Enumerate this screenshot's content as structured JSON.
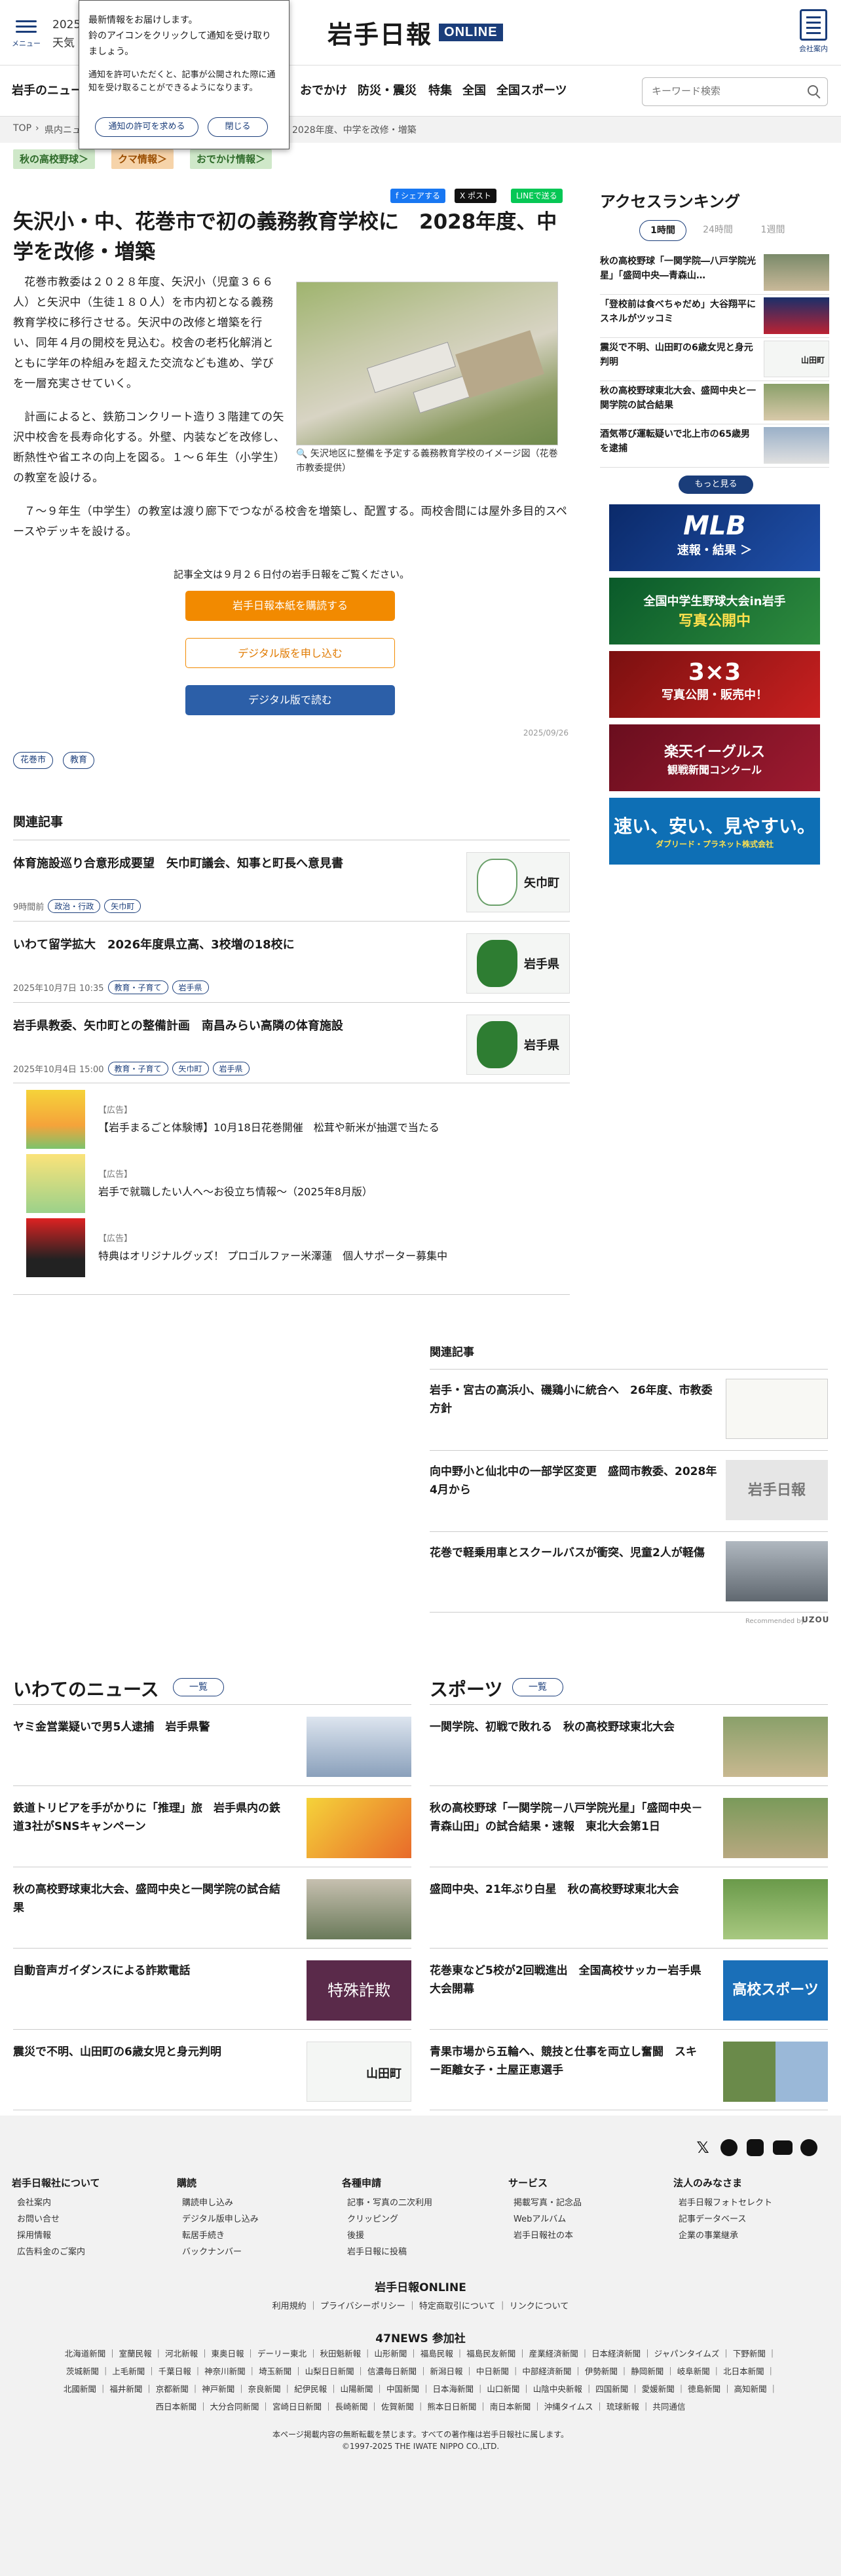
{
  "header": {
    "menu_label": "メニュー",
    "date_text": "2025.",
    "weather_text": "天気",
    "logo_jp": "岩手日報",
    "logo_online": "ONLINE",
    "company_label": "会社案内"
  },
  "popup": {
    "line1": "最新情報をお届けします。",
    "line2": "鈴のアイコンをクリックして通知を受け取りましょう。",
    "line3": "通知を許可いただくと、記事が公開された際に通知を受け取ることができるようになります。",
    "allow_button": "通知の許可を求める",
    "close_button": "閉じる"
  },
  "nav": {
    "items": [
      "岩手のニュー",
      "おでかけ",
      "防災・震災",
      "特集",
      "全国",
      "全国スポーツ"
    ],
    "search_placeholder": "キーワード検索"
  },
  "breadcrumb": {
    "top": "TOP",
    "sep": "›",
    "section": "県内ニュ",
    "current": "2028年度、中学を改修・増築"
  },
  "topic_tags": [
    "秋の高校野球＞",
    "クマ情報＞",
    "おでかけ情報＞"
  ],
  "share": {
    "facebook": "f シェアする",
    "x": "X ポスト",
    "line": "LINEで送る"
  },
  "article": {
    "title": "矢沢小・中、花巻市で初の義務教育学校に　2028年度、中学を改修・増築",
    "para1": "花巻市教委は２０２８年度、矢沢小（児童３６６人）と矢沢中（生徒１８０人）を市内初となる義務教育学校に移行させる。矢沢中の改修と増築を行い、同年４月の開校を見込む。校舎の老朽化解消とともに学年の枠組みを超えた交流なども進め、学びを一層充実させていく。",
    "para2": "計画によると、鉄筋コンクリート造り３階建ての矢沢中校舎を長寿命化する。外壁、内装などを改修し、断熱性や省エネの向上を図る。１～６年生（小学生）の教室を設ける。",
    "para3": "７～９年生（中学生）の教室は渡り廊下でつながる校舎を増築し、配置する。両校舎間には屋外多目的スペースやデッキを設ける。",
    "image_caption": "矢沢地区に整備を予定する義務教育学校のイメージ図（花巻市教委提供）",
    "paywall_note": "記事全文は９月２６日付の岩手日報をご覧ください。",
    "btn_buy": "岩手日報本紙を購読する",
    "btn_digital_apply": "デジタル版を申し込む",
    "btn_digital_read": "デジタル版で読む",
    "date": "2025/09/26",
    "keywords": [
      "花巻市",
      "教育"
    ]
  },
  "related": {
    "heading": "関連記事",
    "items": [
      {
        "title": "体育施設巡り合意形成要望　矢巾町議会、知事と町長へ意見書",
        "meta": "9時間前",
        "tags": [
          "政治・行政",
          "矢巾町"
        ],
        "thumb_label": "矢巾町",
        "thumb_color": "#ffffff"
      },
      {
        "title": "いわて留学拡大　2026年度県立高、3校増の18校に",
        "meta": "2025年10月7日 10:35",
        "tags": [
          "教育・子育て",
          "岩手県"
        ],
        "thumb_label": "岩手県",
        "thumb_color": "#2e7d32"
      },
      {
        "title": "岩手県教委、矢巾町との整備計画　南昌みらい高隣の体育施設",
        "meta": "2025年10月4日 15:00",
        "tags": [
          "教育・子育て",
          "矢巾町",
          "岩手県"
        ],
        "thumb_label": "岩手県",
        "thumb_color": "#2e7d32"
      }
    ]
  },
  "ads": [
    {
      "pr": "【広告】",
      "title": "【岩手まるごと体験博】10月18日花巻開催　松茸や新米が抽選で当たる"
    },
    {
      "pr": "【広告】",
      "title": "岩手で就職したい人へ～お役立ち情報～（2025年8月版）"
    },
    {
      "pr": "【広告】",
      "title": "特典はオリジナルグッズ！ プロゴルファー米澤蓮　個人サポーター募集中"
    }
  ],
  "ranking": {
    "title": "アクセスランキング",
    "tabs": [
      "1時間",
      "24時間",
      "1週間"
    ],
    "items": [
      "秋の高校野球「一関学院―八戸学院光星」「盛岡中央―青森山…",
      "「登校前は食べちゃだめ」大谷翔平にスネルがツッコミ",
      "震災で不明、山田町の6歳女児と身元判明",
      "秋の高校野球東北大会、盛岡中央と一関学院の試合結果",
      "酒気帯び運転疑いで北上市の65歳男を逮捕"
    ],
    "more": "もっと見る"
  },
  "banners": [
    {
      "line1": "MLB",
      "line2": "速報・結果 ＞"
    },
    {
      "line1": "全国中学生野球大会in岩手",
      "line2": "写真公開中"
    },
    {
      "line1": "3×3",
      "line2": "写真公開・販売中！"
    },
    {
      "line1": "楽天イーグルス",
      "line2": "観戦新聞コンクール"
    },
    {
      "line1": "速い、安い、見やすい。",
      "line2": "ダブリード・プラネット株式会社"
    }
  ],
  "recommend": {
    "heading": "関連記事",
    "items": [
      "岩手・宮古の高浜小、磯鶏小に統合へ　26年度、市教委方針",
      "向中野小と仙北中の一部学区変更　盛岡市教委、2028年4月から",
      "花巻で軽乗用車とスクールバスが衝突、児童2人が軽傷"
    ],
    "credit": "Recommended by"
  },
  "iwate_news": {
    "heading": "いわてのニュース",
    "more": "一覧",
    "items": [
      "ヤミ金営業疑いで男5人逮捕　岩手県警",
      "鉄道トリビアを手がかりに「推理」旅　岩手県内の鉄道3社がSNSキャンペーン",
      "秋の高校野球東北大会、盛岡中央と一関学院の試合結果",
      "自動音声ガイダンスによる詐欺電話",
      "震災で不明、山田町の6歳女児と身元判明"
    ],
    "thumb_labels": [
      "",
      "",
      "",
      "特殊詐欺",
      "山田町"
    ]
  },
  "sports": {
    "heading": "スポーツ",
    "more": "一覧",
    "items": [
      "一関学院、初戦で敗れる　秋の高校野球東北大会",
      "秋の高校野球「一関学院－八戸学院光星」「盛岡中央－青森山田」の試合結果・速報　東北大会第1日",
      "盛岡中央、21年ぶり白星　秋の高校野球東北大会",
      "花巻東など5校が2回戦進出　全国高校サッカー岩手県大会開幕",
      "青果市場から五輪へ、競技と仕事を両立し奮闘　スキー距離女子・土屋正恵選手"
    ],
    "thumb_labels": [
      "",
      "",
      "",
      "高校スポーツ",
      ""
    ]
  },
  "footer": {
    "columns": [
      {
        "heading": "岩手日報社について",
        "links": [
          "会社案内",
          "お問い合せ",
          "採用情報",
          "広告料金のご案内"
        ]
      },
      {
        "heading": "購読",
        "links": [
          "購読申し込み",
          "デジタル版申し込み",
          "転居手続き",
          "バックナンバー"
        ]
      },
      {
        "heading": "各種申請",
        "links": [
          "記事・写真の二次利用",
          "クリッピング",
          "後援",
          "岩手日報に投稿"
        ]
      },
      {
        "heading": "サービス",
        "links": [
          "掲載写真・記念品",
          "Webアルバム",
          "岩手日報社の本"
        ]
      },
      {
        "heading": "法人のみなさま",
        "links": [
          "岩手日報フォトセレクト",
          "記事データベース",
          "企業の事業継承"
        ]
      }
    ],
    "site_name": "岩手日報ONLINE",
    "policy_links": "利用規約 ｜ プライバシーポリシー ｜ 特定商取引について ｜ リンクについて",
    "partners_heading": "47NEWS 参加社",
    "partners_line1": "北海道新聞 ｜ 室蘭民報 ｜ 河北新報 ｜ 東奥日報 ｜ デーリー東北 ｜ 秋田魁新報 ｜ 山形新聞 ｜ 福島民報 ｜ 福島民友新聞 ｜ 産業経済新聞 ｜ 日本経済新聞 ｜ ジャパンタイムズ ｜ 下野新聞 ｜",
    "partners_line2": "茨城新聞 ｜ 上毛新聞 ｜ 千葉日報 ｜ 神奈川新聞 ｜ 埼玉新聞 ｜ 山梨日日新聞 ｜ 信濃毎日新聞 ｜ 新潟日報 ｜ 中日新聞 ｜ 中部経済新聞 ｜ 伊勢新聞 ｜ 静岡新聞 ｜ 岐阜新聞 ｜ 北日本新聞 ｜",
    "partners_line3": "北國新聞 ｜ 福井新聞 ｜ 京都新聞 ｜ 神戸新聞 ｜ 奈良新聞 ｜ 紀伊民報 ｜ 山陽新聞 ｜ 中国新聞 ｜ 日本海新聞 ｜ 山口新聞 ｜ 山陰中央新報 ｜ 四国新聞 ｜ 愛媛新聞 ｜ 徳島新聞 ｜ 高知新聞 ｜",
    "partners_line4": "西日本新聞 ｜ 大分合同新聞 ｜ 宮崎日日新聞 ｜ 長崎新聞 ｜ 佐賀新聞 ｜ 熊本日日新聞 ｜ 南日本新聞 ｜ 沖縄タイムス ｜ 琉球新報 ｜ 共同通信",
    "copyright1": "本ページ掲載内容の無断転載を禁じます。すべての著作権は岩手日報社に属します。",
    "copyright2": "©1997-2025 THE IWATE NIPPO CO.,LTD."
  }
}
